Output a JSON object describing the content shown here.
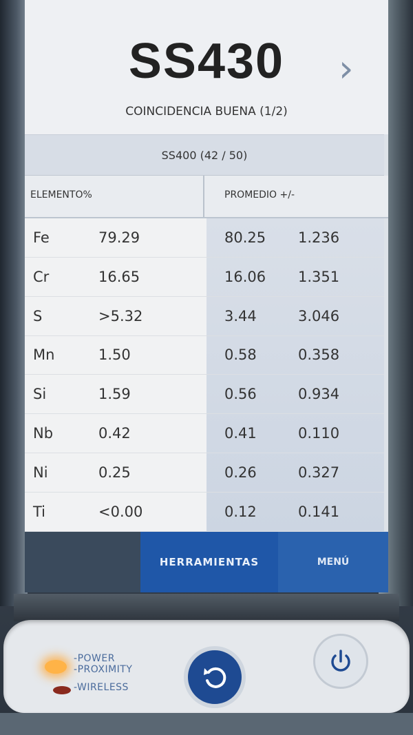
{
  "header": {
    "alloy_grade": "SS430",
    "match_quality": "COINCIDENCIA BUENA (1/2)",
    "alternate_match": "SS400 (42 / 50)"
  },
  "table": {
    "left_header": "ELEMENTO%",
    "right_header": "PROMEDIO +/-",
    "rows": [
      {
        "element": "Fe",
        "pct": "79.29",
        "avg": "80.25",
        "err": "1.236"
      },
      {
        "element": "Cr",
        "pct": "16.65",
        "avg": "16.06",
        "err": "1.351"
      },
      {
        "element": "S",
        "pct": ">5.32",
        "avg": "3.44",
        "err": "3.046"
      },
      {
        "element": "Mn",
        "pct": "1.50",
        "avg": "0.58",
        "err": "0.358"
      },
      {
        "element": "Si",
        "pct": "1.59",
        "avg": "0.56",
        "err": "0.934"
      },
      {
        "element": "Nb",
        "pct": "0.42",
        "avg": "0.41",
        "err": "0.110"
      },
      {
        "element": "Ni",
        "pct": "0.25",
        "avg": "0.26",
        "err": "0.327"
      },
      {
        "element": "Ti",
        "pct": "<0.00",
        "avg": "0.12",
        "err": "0.141"
      }
    ]
  },
  "footer": {
    "tools_label": "HERRAMIENTAS",
    "menu_label": "MENÚ"
  },
  "hardware": {
    "power_label": "POWER",
    "proximity_label": "PROXIMITY",
    "wireless_label": "WIRELESS"
  },
  "colors": {
    "accent_blue": "#1f57a8",
    "power_led": "#ffb347",
    "wireless_led": "#8a2a1e"
  }
}
